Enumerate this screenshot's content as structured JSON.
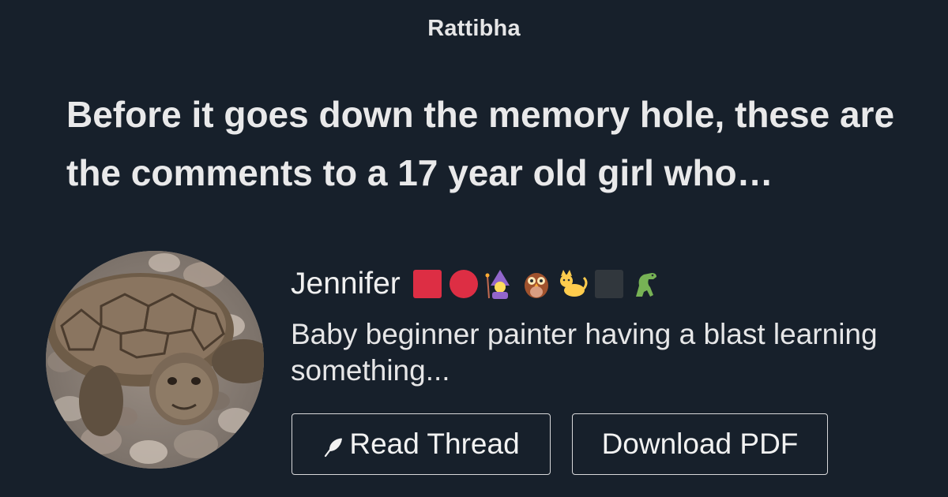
{
  "brand": {
    "name": "Rattibha"
  },
  "thread": {
    "title": "Before it goes down the memory hole, these are the comments to a 17 year old girl who…"
  },
  "author": {
    "name": "Jennifer",
    "name_emojis": [
      "red-square",
      "red-circle",
      "woman-mage",
      "owl",
      "cat",
      "black-square",
      "t-rex"
    ],
    "bio": "Baby beginner painter having a blast learning something...",
    "avatar": "tortoise-photo"
  },
  "actions": {
    "read_thread_label": "Read Thread",
    "read_thread_icon": "feather-icon",
    "download_pdf_label": "Download PDF"
  },
  "colors": {
    "background": "#17202b",
    "text": "#e9e9ea",
    "button_border": "#d8d8da"
  }
}
